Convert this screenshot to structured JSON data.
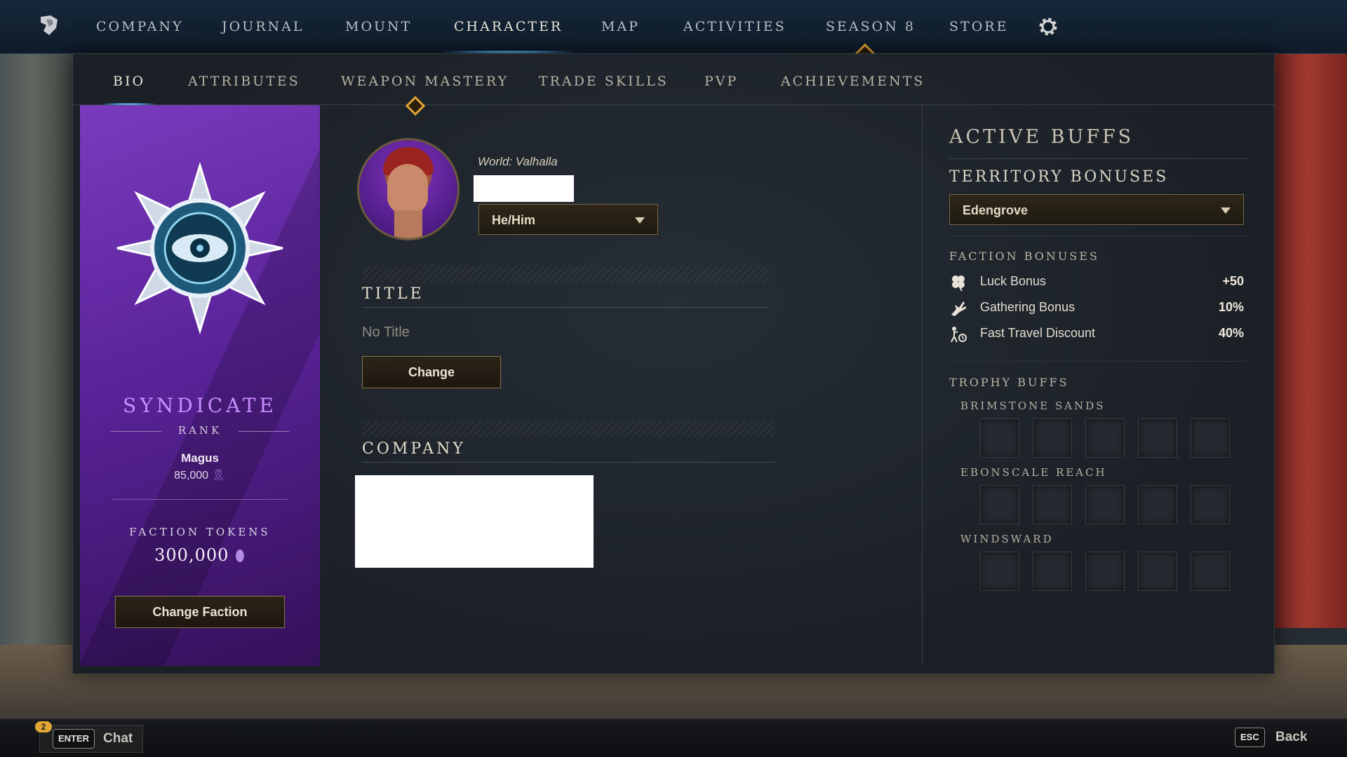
{
  "top_nav": {
    "items": [
      "COMPANY",
      "JOURNAL",
      "MOUNT",
      "CHARACTER",
      "MAP",
      "ACTIVITIES",
      "SEASON 8",
      "STORE"
    ],
    "active": "CHARACTER"
  },
  "sub_tabs": {
    "items": [
      "BIO",
      "ATTRIBUTES",
      "WEAPON MASTERY",
      "TRADE SKILLS",
      "PVP",
      "ACHIEVEMENTS"
    ],
    "active": "BIO"
  },
  "faction": {
    "name": "SYNDICATE",
    "rank_label": "RANK",
    "rank_name": "Magus",
    "rank_points": "85,000",
    "tokens_label": "FACTION TOKENS",
    "tokens_value": "300,000",
    "change_button": "Change Faction",
    "accent_color": "#7a3bbd"
  },
  "bio": {
    "world": "World: Valhalla",
    "pronouns": "He/Him",
    "title_heading": "TITLE",
    "title_value": "No Title",
    "change_button": "Change",
    "company_heading": "COMPANY"
  },
  "buffs": {
    "heading": "ACTIVE BUFFS",
    "territory_heading": "TERRITORY BONUSES",
    "territory_selected": "Edengrove",
    "faction_heading": "FACTION BONUSES",
    "faction_bonuses": [
      {
        "icon": "clover-icon",
        "label": "Luck Bonus",
        "value": "+50"
      },
      {
        "icon": "gathering-hand-icon",
        "label": "Gathering Bonus",
        "value": "10%"
      },
      {
        "icon": "fast-travel-icon",
        "label": "Fast Travel Discount",
        "value": "40%"
      }
    ],
    "trophy_heading": "TROPHY BUFFS",
    "trophy_groups": [
      {
        "name": "BRIMSTONE SANDS"
      },
      {
        "name": "EBONSCALE REACH"
      },
      {
        "name": "WINDSWARD"
      }
    ]
  },
  "bottom_bar": {
    "chat_badge": "2",
    "chat_key": "ENTER",
    "chat_label": "Chat",
    "back_key": "ESC",
    "back_label": "Back"
  },
  "colors": {
    "accent_gold": "#e0a634",
    "active_tab_glow": "#7fd0ff"
  }
}
